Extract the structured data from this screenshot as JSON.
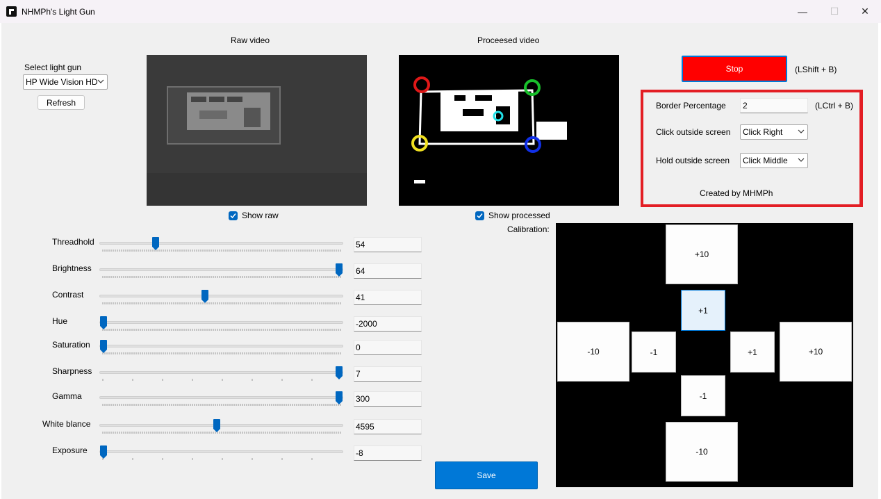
{
  "window": {
    "title": "NHMPh's Light Gun",
    "minimize": "—",
    "maximize": "☐",
    "close": "✕"
  },
  "gun": {
    "label": "Select light gun",
    "selected": "HP Wide Vision HD",
    "refresh": "Refresh"
  },
  "raw": {
    "header": "Raw video",
    "show_label": "Show raw",
    "checked": true
  },
  "processed": {
    "header": "Proceesed video",
    "show_label": "Show processed",
    "checked": true
  },
  "controls": {
    "stop": "Stop",
    "stop_hotkey": "(LShift + B)",
    "border_label": "Border Percentage",
    "border_value": "2",
    "border_hotkey": "(LCtrl + B)",
    "click_label": "Click outside screen",
    "click_value": "Click Right",
    "hold_label": "Hold outside screen",
    "hold_value": "Click Middle",
    "credit": "Created by MHMPh",
    "accent_color": "#e31e24"
  },
  "sliders": [
    {
      "label": "Threadhold",
      "value": "54",
      "level": 0.22
    },
    {
      "label": "Brightness",
      "value": "64",
      "level": 1.0
    },
    {
      "label": "Contrast",
      "value": "41",
      "level": 0.43
    },
    {
      "label": "Hue",
      "value": "-2000",
      "level": 0.0
    },
    {
      "label": "Saturation",
      "value": "0",
      "level": 0.0
    },
    {
      "label": "Sharpness",
      "value": "7",
      "level": 1.0
    },
    {
      "label": "Gamma",
      "value": "300",
      "level": 1.0
    },
    {
      "label": "White blance",
      "value": "4595",
      "level": 0.48
    },
    {
      "label": "Exposure",
      "value": "-8",
      "level": 0.0
    }
  ],
  "calibration": {
    "label": "Calibration:",
    "up10": "+10",
    "up1": "+1",
    "left10": "-10",
    "left1": "-1",
    "right1": "+1",
    "right10": "+10",
    "down1": "-1",
    "down10": "-10"
  },
  "save": "Save"
}
